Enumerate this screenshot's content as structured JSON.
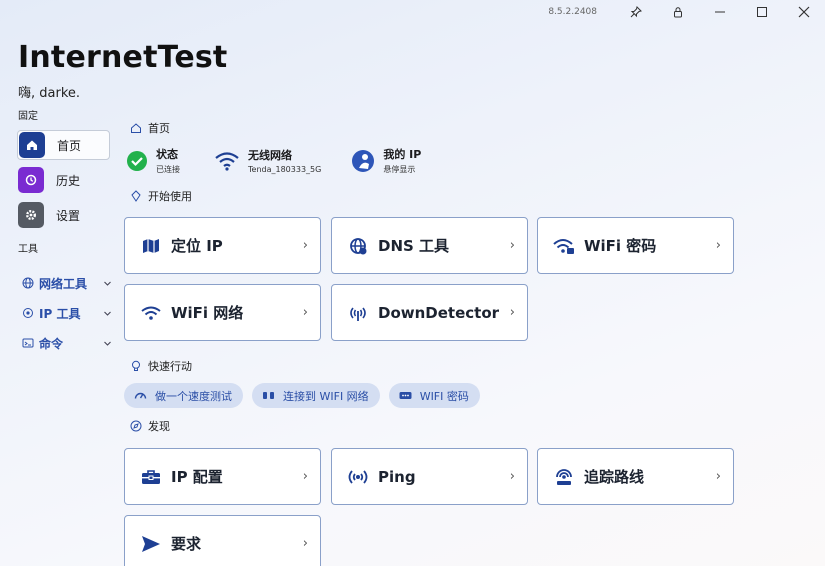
{
  "titlebar": {
    "version": "8.5.2.2408"
  },
  "app": {
    "title": "InternetTest",
    "greeting": "嗨, darke."
  },
  "sidebar": {
    "pinned_label": "固定",
    "items": [
      {
        "label": "首页",
        "icon": "home-icon",
        "color": "#1e3f93"
      },
      {
        "label": "历史",
        "icon": "history-icon",
        "color": "#7a2bd1"
      },
      {
        "label": "设置",
        "icon": "gear-icon",
        "color": "#555a63"
      }
    ],
    "tools_label": "工具",
    "tools": [
      {
        "label": "网络工具",
        "icon": "globe-icon"
      },
      {
        "label": "IP 工具",
        "icon": "location-icon"
      },
      {
        "label": "命令",
        "icon": "command-icon"
      }
    ]
  },
  "main": {
    "home_label": "首页",
    "status": [
      {
        "title": "状态",
        "sub": "已连接",
        "icon": "check-circle-icon"
      },
      {
        "title": "无线网络",
        "sub": "Tenda_180333_5G",
        "icon": "wifi-icon"
      },
      {
        "title": "我的 IP",
        "sub": "悬停显示",
        "icon": "globe-person-icon"
      }
    ],
    "get_started_label": "开始使用",
    "get_started_cards": [
      {
        "label": "定位 IP",
        "icon": "map-icon"
      },
      {
        "label": "DNS 工具",
        "icon": "dns-icon"
      },
      {
        "label": "WiFi 密码",
        "icon": "wifi-lock-icon"
      },
      {
        "label": "WiFi 网络",
        "icon": "wifi-icon"
      },
      {
        "label": "DownDetector",
        "icon": "signal-icon"
      }
    ],
    "quick_actions_label": "快速行动",
    "quick_actions": [
      {
        "label": "做一个速度测试",
        "icon": "speed-icon"
      },
      {
        "label": "连接到 WIFI 网络",
        "icon": "plug-icon"
      },
      {
        "label": "WIFI 密码",
        "icon": "password-icon"
      }
    ],
    "discover_label": "发现",
    "discover_cards": [
      {
        "label": "IP 配置",
        "icon": "toolbox-icon"
      },
      {
        "label": "Ping",
        "icon": "ping-icon"
      },
      {
        "label": "追踪路线",
        "icon": "trace-icon"
      },
      {
        "label": "要求",
        "icon": "send-icon"
      }
    ]
  }
}
